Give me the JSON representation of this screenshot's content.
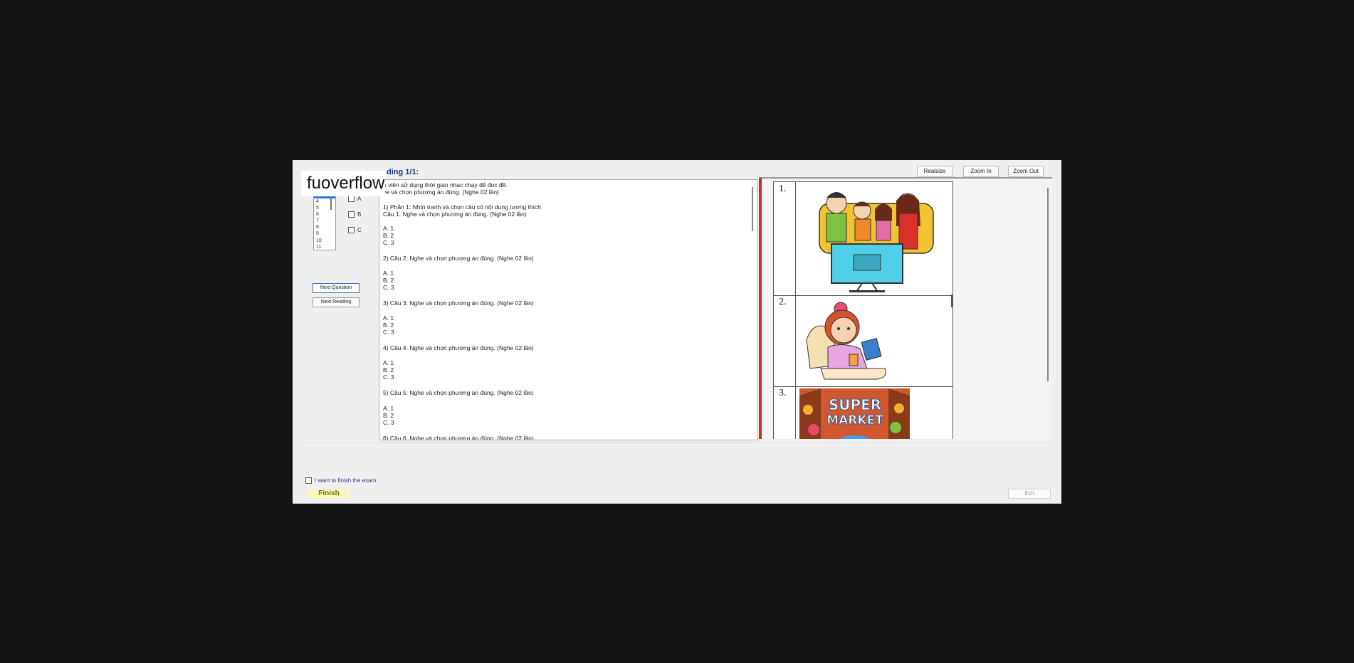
{
  "watermark": "fuoverflow",
  "header": {
    "title": "ding 1/1:",
    "buttons": {
      "realsize": "Realsize",
      "zoom_in": "Zoom In",
      "zoom_out": "Zoom Out"
    }
  },
  "question_list": {
    "items": [
      "4",
      "5",
      "6",
      "7",
      "8",
      "9",
      "10",
      "11"
    ]
  },
  "answer_options": [
    "A",
    "B",
    "C"
  ],
  "nav": {
    "next_question": "Next Question",
    "next_reading": "Next Reading"
  },
  "question_text": {
    "lines": [
      "h viên sử dụng thời gian nhạc chạy để đọc đề.",
      "ye và chọn phương án đúng. (Nghe 02 lần)",
      "1) Phần 1: Nhìn tranh và chọn câu có nội dung tương thích",
      "Câu 1: Nghe và chọn phương án đúng. (Nghe 02 lần)",
      "A. 1",
      "B. 2",
      "C. 3",
      "2) Câu 2: Nghe và chọn phương án đúng. (Nghe 02 lần)",
      "A. 1",
      "B. 2",
      "C. 3",
      "3) Câu 3: Nghe và chọn phương án đúng. (Nghe 02 lần)",
      "A. 1",
      "B. 2",
      "C. 3",
      "4) Câu 4: Nghe và chọn phương án đúng. (Nghe 02 lần)",
      "A. 1",
      "B. 2",
      "C. 3",
      "5) Câu 5: Nghe và chọn phương án đúng. (Nghe 02 lần)",
      "A. 1",
      "B. 2",
      "C. 3",
      "6) Câu 6: Nghe và chọn phương án đúng. (Nghe 02 lần)"
    ]
  },
  "images": {
    "numbers": [
      "1.",
      "2.",
      "3."
    ],
    "supermarket_text": [
      "SUPER",
      "MARKET"
    ]
  },
  "footer": {
    "finish_checkbox_label": "I want to finish the exam",
    "finish_button": "Finish",
    "exit_button": "Exit"
  },
  "colors": {
    "separator": "#c9302c",
    "finish_bg": "#fff7b8",
    "title": "#1a3a8c"
  }
}
